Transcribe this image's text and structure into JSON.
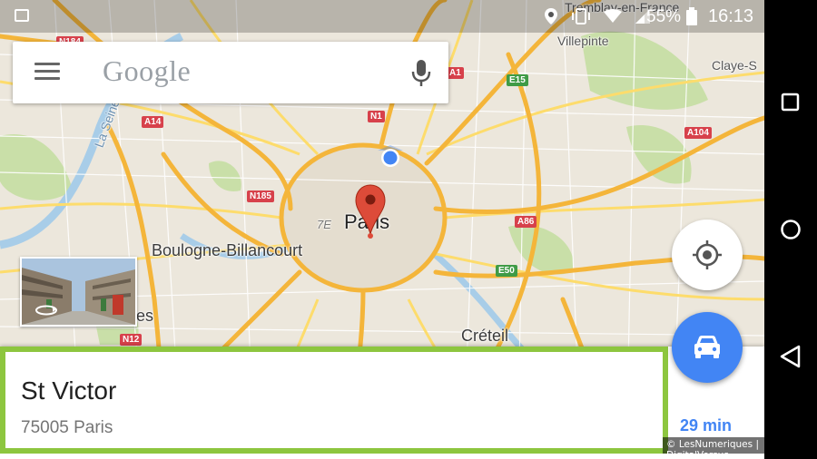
{
  "status_bar": {
    "battery_percent": "55%",
    "time": "16:13",
    "icons": [
      "picture-icon",
      "location-icon",
      "vibrate-icon",
      "wifi-icon",
      "signal-icon",
      "battery-icon"
    ]
  },
  "search": {
    "logo_text": "Google",
    "icons": [
      "menu-icon",
      "mic-icon"
    ]
  },
  "map": {
    "center_label": "Paris",
    "district_label": "7E",
    "places": {
      "tremblay": "Tremblay-en-France",
      "villepinte": "Villepinte",
      "claye": "Claye-S",
      "boulogne": "Boulogne-Billancourt",
      "creteil": "Créteil",
      "river": "La Seine",
      "es": "es"
    },
    "road_labels": {
      "n184": "N184",
      "a1": "A1",
      "e15": "E15",
      "n1": "N1",
      "a14": "A14",
      "a104": "A104",
      "n185": "N185",
      "a86": "A86",
      "e50": "E50",
      "n12": "N12"
    },
    "colors": {
      "highway": "#f4b53a",
      "road": "#fddc6c",
      "water": "#a8cde8",
      "park": "#c9dfa8",
      "marker": "#dd4b39",
      "my_location": "#4285f4"
    }
  },
  "buttons": {
    "locate_icon": "crosshair-icon",
    "directions_icon": "car-icon"
  },
  "place_card": {
    "name": "St Victor",
    "address": "75005 Paris",
    "duration": "29 min"
  },
  "credit": "© LesNumeriques | DigitalVersus",
  "nav_bar": {
    "icons": [
      "recents-icon",
      "home-icon",
      "back-icon"
    ]
  }
}
